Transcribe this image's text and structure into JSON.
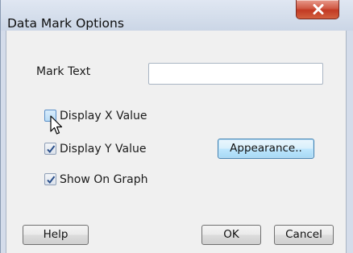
{
  "window": {
    "title": "Data Mark Options",
    "close_symbol": "close-icon"
  },
  "mark_text": {
    "label": "Mark Text",
    "value": ""
  },
  "options": [
    {
      "label": "Display X Value",
      "checked": false
    },
    {
      "label": "Display Y Value",
      "checked": true
    },
    {
      "label": "Show On Graph",
      "checked": true
    }
  ],
  "buttons": {
    "appearance": "Appearance..",
    "help": "Help",
    "ok": "OK",
    "cancel": "Cancel"
  },
  "colors": {
    "close_button": "#c94a33",
    "focus_button": "#bee6fd",
    "check": "#2a4f8a"
  },
  "icons": {
    "checkmark": "check-icon",
    "mouse_pointer": "mouse-cursor-icon"
  }
}
